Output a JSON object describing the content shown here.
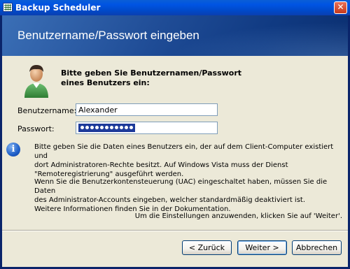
{
  "window": {
    "title": "Backup Scheduler",
    "close": "✕"
  },
  "banner": {
    "heading": "Benutzername/Passwort eingeben"
  },
  "form": {
    "intro_line1": "Bitte geben Sie Benutzernamen/Passwort",
    "intro_line2": "eines Benutzers ein:",
    "username_label": "Benutzername:",
    "username_value": "Alexander",
    "password_label": "Passwort:",
    "password_length": 11
  },
  "info": {
    "para1": [
      "Bitte geben Sie die Daten eines Benutzers ein, der auf dem Client-Computer existiert und",
      "dort Administratoren-Rechte besitzt. Auf Windows Vista muss der Dienst",
      "\"Remoteregistrierung\" ausgeführt werden."
    ],
    "para2": [
      "Wenn Sie die Benutzerkontensteuerung (UAC) eingeschaltet haben, müssen Sie die Daten",
      "des Administrator-Accounts eingeben, welcher standardmäßig deaktiviert ist.",
      "Weitere Informationen finden Sie in der Dokumentation."
    ],
    "note": "Um die Einstellungen anzuwenden, klicken Sie auf 'Weiter'."
  },
  "buttons": {
    "back": "< Zurück",
    "next": "Weiter >",
    "cancel": "Abbrechen"
  },
  "colors": {
    "titlebar": "#0054e3",
    "banner": "#1f4c96",
    "dialog_bg": "#ece9d8",
    "selection": "#1d3a9a"
  }
}
